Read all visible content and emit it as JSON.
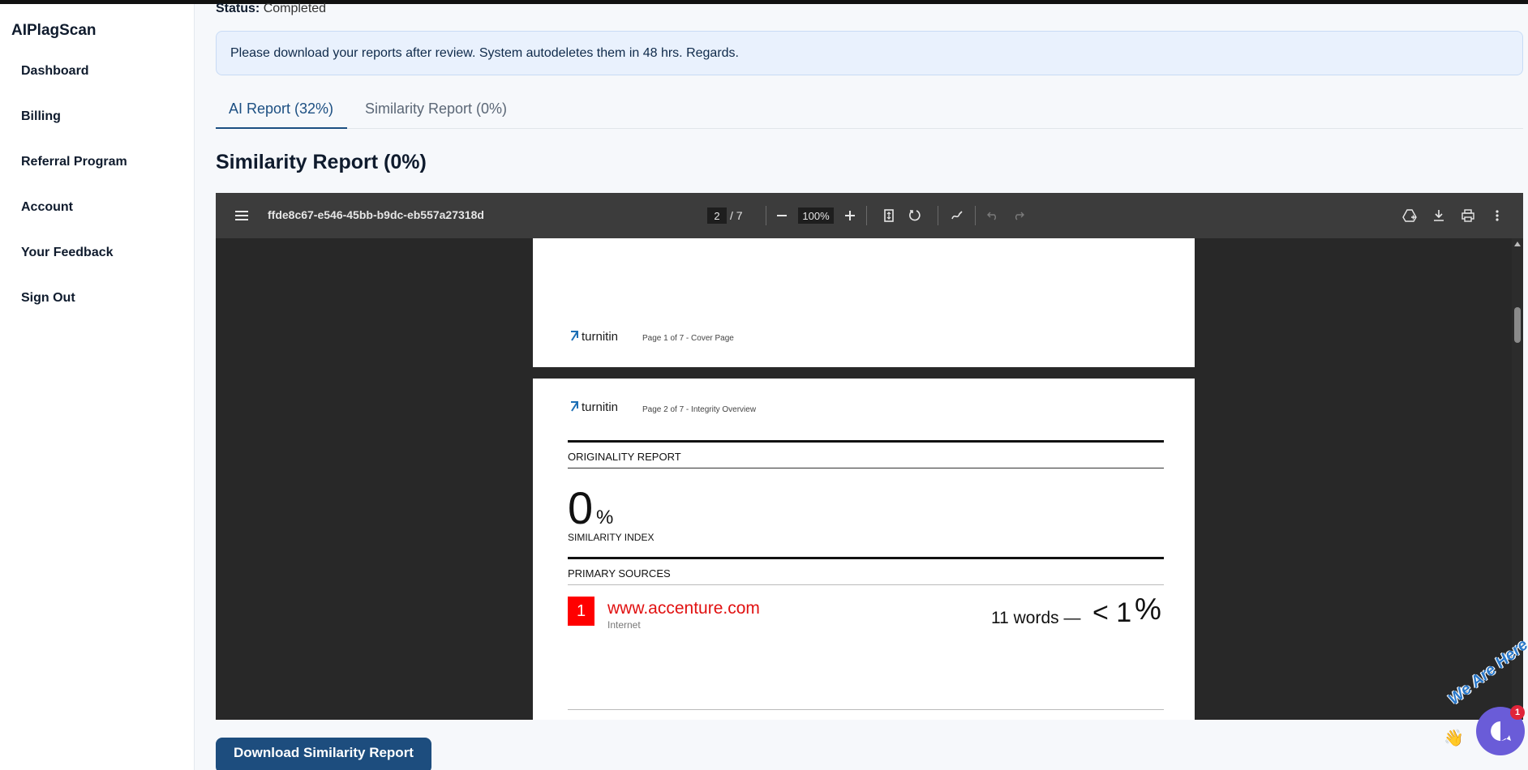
{
  "app": {
    "brand": "AIPlagScan"
  },
  "sidebar": {
    "items": [
      {
        "label": "Dashboard"
      },
      {
        "label": "Billing"
      },
      {
        "label": "Referral Program"
      },
      {
        "label": "Account"
      },
      {
        "label": "Your Feedback"
      },
      {
        "label": "Sign Out"
      }
    ]
  },
  "status": {
    "label": "Status:",
    "value": "Completed"
  },
  "notice": {
    "text": "Please download your reports after review. System autodeletes them in 48 hrs. Regards."
  },
  "tabs": [
    {
      "label": "AI Report (32%)",
      "active": true
    },
    {
      "label": "Similarity Report (0%)",
      "active": false
    }
  ],
  "section": {
    "title": "Similarity Report (0%)"
  },
  "viewer": {
    "filename": "ffde8c67-e546-45bb-b9dc-eb557a27318d",
    "current_page": "2",
    "total_pages": "/ 7",
    "zoom": "100%",
    "icons": {
      "menu": "menu-icon",
      "zoom_out": "minus-icon",
      "zoom_in": "plus-icon",
      "fit": "fit-page-icon",
      "rotate": "rotate-icon",
      "annotate": "annotate-icon",
      "undo": "undo-icon",
      "redo": "redo-icon",
      "drive": "save-to-drive-icon",
      "download": "download-icon",
      "print": "print-icon",
      "more": "more-vertical-icon"
    }
  },
  "pdf": {
    "logo_text": "turnitin",
    "page1_caption": "Page 1 of 7 - Cover Page",
    "page2_caption": "Page 2 of 7 - Integrity Overview",
    "originality_label": "ORIGINALITY REPORT",
    "similarity_index_value": "0",
    "similarity_index_sign": "%",
    "similarity_index_label": "SIMILARITY INDEX",
    "primary_sources_label": "PRIMARY SOURCES",
    "sources": [
      {
        "rank": "1",
        "site": "www.accenture.com",
        "type": "Internet",
        "words": "11 words —",
        "lt": "< 1",
        "pct": "%"
      }
    ]
  },
  "download_button": {
    "label": "Download Similarity Report"
  },
  "chat": {
    "banner": "We Are Here",
    "badge": "1",
    "hand": "👋"
  },
  "colors": {
    "brand_blue": "#1d4d7e",
    "source_red": "#ff0000",
    "chat_purple": "#6a5cd8"
  }
}
